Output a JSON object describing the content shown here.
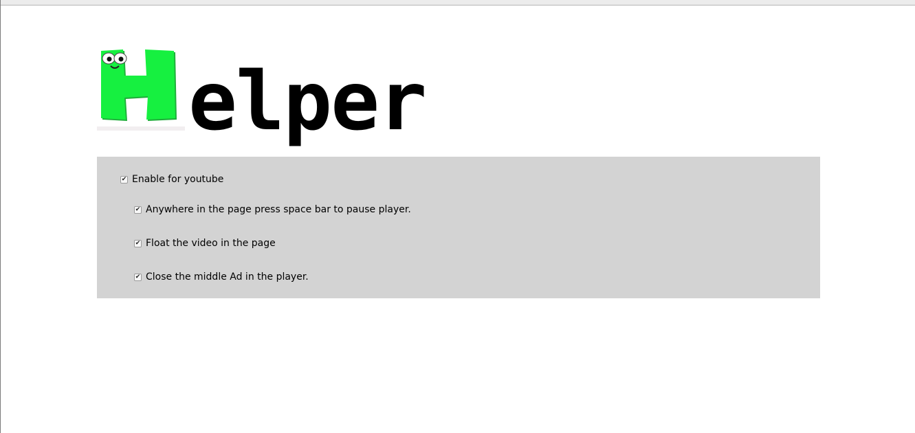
{
  "logo": {
    "text": "elper",
    "colors": {
      "letter": "#16f040",
      "letter_edge": "#1fae3a",
      "eye": "#ffffff",
      "pupil": "#111111"
    }
  },
  "options": {
    "main": {
      "label": "Enable for youtube",
      "checked": true
    },
    "items": [
      {
        "label": "Anywhere in the page press space bar to pause player.",
        "checked": true
      },
      {
        "label": "Float the video in the page",
        "checked": true
      },
      {
        "label": "Close the middle Ad in the player.",
        "checked": true
      }
    ]
  },
  "icons": {
    "logo_mascot": "green-letter-h-with-eyes-icon",
    "checkbox": "checkmark-icon"
  },
  "colors": {
    "panel_bg": "#d3d3d3",
    "text": "#000000"
  }
}
